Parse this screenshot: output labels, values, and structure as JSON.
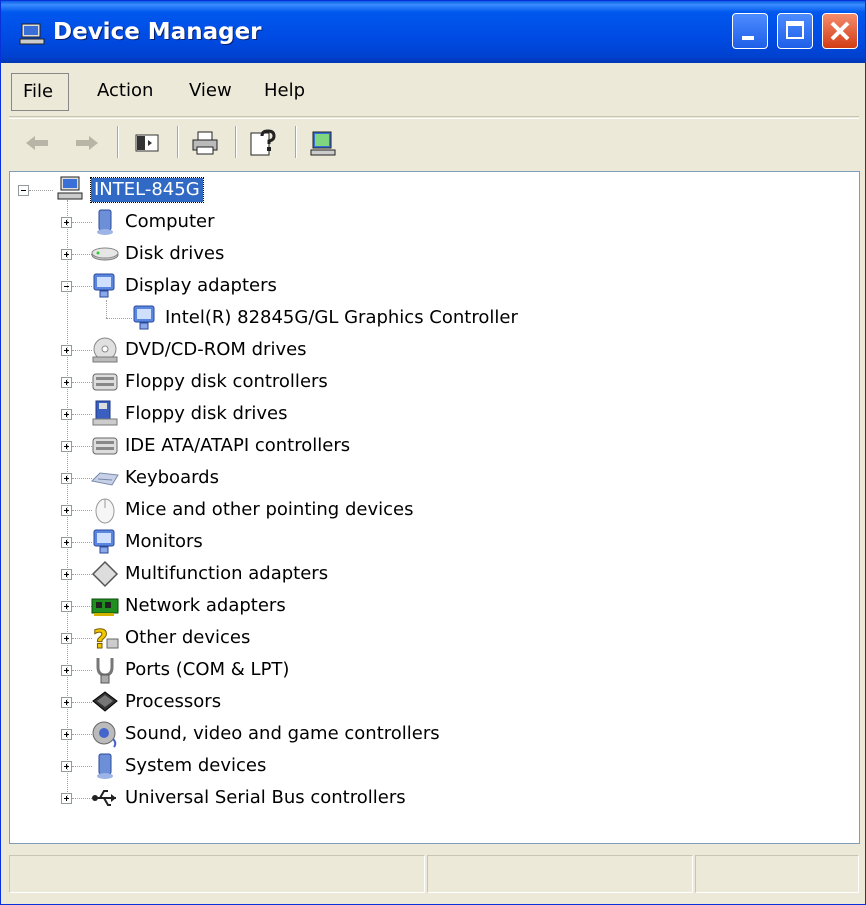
{
  "window": {
    "title": "Device Manager"
  },
  "menu": [
    "File",
    "Action",
    "View",
    "Help"
  ],
  "tree": {
    "root": "INTEL-845G",
    "items": [
      {
        "label": "Computer",
        "icon": "computer-icon",
        "expanded": false
      },
      {
        "label": "Disk drives",
        "icon": "disk-drive-icon",
        "expanded": false
      },
      {
        "label": "Display adapters",
        "icon": "monitor-icon",
        "expanded": true,
        "children": [
          {
            "label": "Intel(R) 82845G/GL Graphics Controller",
            "icon": "monitor-icon"
          }
        ]
      },
      {
        "label": "DVD/CD-ROM drives",
        "icon": "cdrom-icon",
        "expanded": false
      },
      {
        "label": "Floppy disk controllers",
        "icon": "controller-icon",
        "expanded": false
      },
      {
        "label": "Floppy disk drives",
        "icon": "floppy-icon",
        "expanded": false
      },
      {
        "label": "IDE ATA/ATAPI controllers",
        "icon": "controller-icon",
        "expanded": false
      },
      {
        "label": "Keyboards",
        "icon": "keyboard-icon",
        "expanded": false
      },
      {
        "label": "Mice and other pointing devices",
        "icon": "mouse-icon",
        "expanded": false
      },
      {
        "label": "Monitors",
        "icon": "monitor-icon",
        "expanded": false
      },
      {
        "label": "Multifunction adapters",
        "icon": "multifunction-icon",
        "expanded": false
      },
      {
        "label": "Network adapters",
        "icon": "network-card-icon",
        "expanded": false
      },
      {
        "label": "Other devices",
        "icon": "question-icon",
        "expanded": false
      },
      {
        "label": "Ports (COM & LPT)",
        "icon": "port-icon",
        "expanded": false
      },
      {
        "label": "Processors",
        "icon": "processor-icon",
        "expanded": false
      },
      {
        "label": "Sound, video and game controllers",
        "icon": "sound-icon",
        "expanded": false
      },
      {
        "label": "System devices",
        "icon": "system-icon",
        "expanded": false
      },
      {
        "label": "Universal Serial Bus controllers",
        "icon": "usb-icon",
        "expanded": false
      }
    ]
  },
  "colors": {
    "titlebar": "#0054e3",
    "selection": "#316ac5",
    "chrome": "#ece9d8"
  }
}
